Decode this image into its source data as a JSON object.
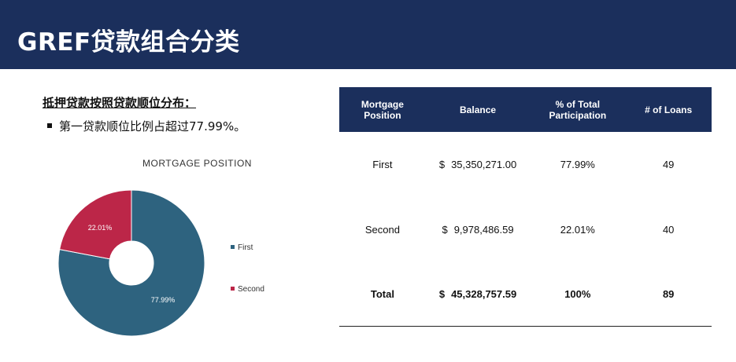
{
  "header": {
    "title": "GREF贷款组合分类"
  },
  "section": {
    "heading": "抵押贷款按照贷款顺位分布：",
    "bullet": "第一贷款顺位比例占超过77.99%。"
  },
  "colors": {
    "header_bg": "#1b2f5c",
    "first": "#2e637f",
    "second": "#bc2648"
  },
  "chart_data": {
    "type": "pie",
    "donut": true,
    "title": "MORTGAGE POSITION",
    "categories": [
      "First",
      "Second"
    ],
    "values": [
      77.99,
      22.01
    ],
    "data_labels": [
      "77.99%",
      "22.01%"
    ],
    "legend_position": "right"
  },
  "table": {
    "headers": [
      "Mortgage Position",
      "Balance",
      "% of Total Participation",
      "# of Loans"
    ],
    "rows": [
      {
        "position": "First",
        "currency": "$",
        "balance": "35,350,271.00",
        "percent": "77.99%",
        "loans": "49"
      },
      {
        "position": "Second",
        "currency": "$",
        "balance": "9,978,486.59",
        "percent": "22.01%",
        "loans": "40"
      }
    ],
    "total": {
      "position": "Total",
      "currency": "$",
      "balance": "45,328,757.59",
      "percent": "100%",
      "loans": "89"
    }
  }
}
